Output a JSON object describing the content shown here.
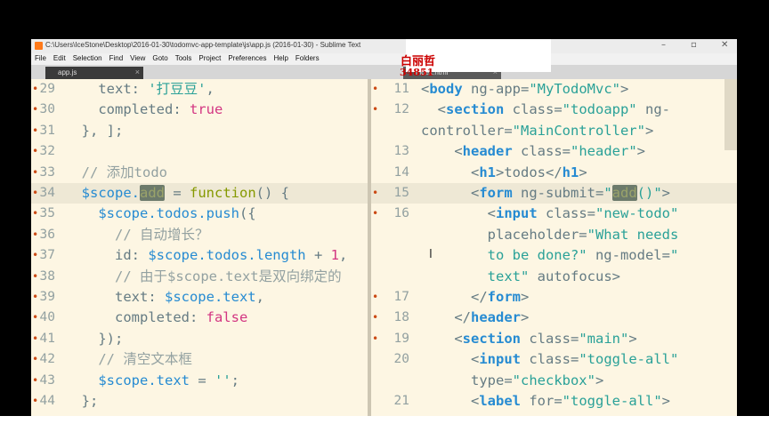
{
  "window": {
    "title": "C:\\Users\\IceStone\\Desktop\\2016-01-30\\todomvc-app-template\\js\\app.js (2016-01-30) - Sublime Text",
    "controls": {
      "minimize": "–",
      "maximize": "▫",
      "close": "✕"
    }
  },
  "menu": [
    "File",
    "Edit",
    "Selection",
    "Find",
    "View",
    "Goto",
    "Tools",
    "Project",
    "Preferences",
    "Help",
    "Folders"
  ],
  "tabs": [
    {
      "label": "app.js",
      "close": "×"
    },
    {
      "label": "index.html",
      "close": "×"
    }
  ],
  "overlay": {
    "name": "白丽哲",
    "number": "34851"
  },
  "left_pane": {
    "lines": [
      {
        "n": "29",
        "mark": "•",
        "tokens": [
          [
            "pun",
            "    text: "
          ],
          [
            "str",
            "'打豆豆'"
          ],
          [
            "pun",
            ","
          ]
        ]
      },
      {
        "n": "30",
        "mark": "•",
        "tokens": [
          [
            "pun",
            "    completed: "
          ],
          [
            "num",
            "true"
          ]
        ]
      },
      {
        "n": "31",
        "mark": "•",
        "tokens": [
          [
            "pun",
            "  }, ];"
          ]
        ]
      },
      {
        "n": "32",
        "mark": "•",
        "tokens": []
      },
      {
        "n": "33",
        "mark": "•",
        "tokens": [
          [
            "cm",
            "  // 添加todo"
          ]
        ]
      },
      {
        "n": "34",
        "mark": "•",
        "tokens": [
          [
            "var",
            "  $scope."
          ],
          [
            "hl",
            "add"
          ],
          [
            "pun",
            " = "
          ],
          [
            "kw",
            "function"
          ],
          [
            "pun",
            "() {"
          ]
        ]
      },
      {
        "n": "35",
        "mark": "•",
        "tokens": [
          [
            "var",
            "    $scope.todos.push"
          ],
          [
            "pun",
            "({"
          ]
        ]
      },
      {
        "n": "36",
        "mark": "•",
        "tokens": [
          [
            "cm",
            "      // 自动增长？"
          ]
        ]
      },
      {
        "n": "37",
        "mark": "•",
        "tokens": [
          [
            "pun",
            "      id: "
          ],
          [
            "var",
            "$scope.todos.length"
          ],
          [
            "pun",
            " + "
          ],
          [
            "num",
            "1"
          ],
          [
            "pun",
            ","
          ]
        ]
      },
      {
        "n": "38",
        "mark": "•",
        "tokens": [
          [
            "cm",
            "      // 由于$scope.text是双向绑定的"
          ]
        ]
      },
      {
        "n": "39",
        "mark": "•",
        "tokens": [
          [
            "pun",
            "      text: "
          ],
          [
            "var",
            "$scope.text"
          ],
          [
            "pun",
            ","
          ]
        ]
      },
      {
        "n": "40",
        "mark": "•",
        "tokens": [
          [
            "pun",
            "      completed: "
          ],
          [
            "num",
            "false"
          ]
        ]
      },
      {
        "n": "41",
        "mark": "•",
        "tokens": [
          [
            "pun",
            "    });"
          ]
        ]
      },
      {
        "n": "42",
        "mark": "•",
        "tokens": [
          [
            "cm",
            "    // 清空文本框"
          ]
        ]
      },
      {
        "n": "43",
        "mark": "•",
        "tokens": [
          [
            "var",
            "    $scope.text"
          ],
          [
            "pun",
            " = "
          ],
          [
            "str",
            "''"
          ],
          [
            "pun",
            ";"
          ]
        ]
      },
      {
        "n": "44",
        "mark": "•",
        "tokens": [
          [
            "pun",
            "  };"
          ]
        ]
      }
    ]
  },
  "right_pane": {
    "lines": [
      {
        "n": "11",
        "mark": "•",
        "tokens": [
          [
            "pun",
            "<"
          ],
          [
            "tag",
            "body"
          ],
          [
            "pun",
            " ng-app="
          ],
          [
            "str",
            "\"MyTodoMvc\""
          ],
          [
            "pun",
            ">"
          ]
        ]
      },
      {
        "n": "12",
        "mark": "•",
        "tokens": [
          [
            "pun",
            "  <"
          ],
          [
            "tag",
            "section"
          ],
          [
            "pun",
            " class="
          ],
          [
            "str",
            "\"todoapp\""
          ],
          [
            "pun",
            " ng-"
          ]
        ]
      },
      {
        "n": "",
        "mark": "",
        "tokens": [
          [
            "pun",
            "controller="
          ],
          [
            "str",
            "\"MainController\""
          ],
          [
            "pun",
            ">"
          ]
        ]
      },
      {
        "n": "13",
        "mark": "",
        "tokens": [
          [
            "pun",
            "    <"
          ],
          [
            "tag",
            "header"
          ],
          [
            "pun",
            " class="
          ],
          [
            "str",
            "\"header\""
          ],
          [
            "pun",
            ">"
          ]
        ]
      },
      {
        "n": "14",
        "mark": "",
        "tokens": [
          [
            "pun",
            "      <"
          ],
          [
            "tag",
            "h1"
          ],
          [
            "pun",
            ">todos</"
          ],
          [
            "tag",
            "h1"
          ],
          [
            "pun",
            ">"
          ]
        ]
      },
      {
        "n": "15",
        "mark": "•",
        "tokens": [
          [
            "pun",
            "      <"
          ],
          [
            "tag",
            "form"
          ],
          [
            "pun",
            " ng-submit="
          ],
          [
            "str",
            "\""
          ],
          [
            "hl",
            "add"
          ],
          [
            "str",
            "()\""
          ],
          [
            "pun",
            ">"
          ]
        ]
      },
      {
        "n": "16",
        "mark": "•",
        "tokens": [
          [
            "pun",
            "        <"
          ],
          [
            "tag",
            "input"
          ],
          [
            "pun",
            " class="
          ],
          [
            "str",
            "\"new-todo\""
          ]
        ]
      },
      {
        "n": "",
        "mark": "",
        "tokens": [
          [
            "pun",
            "        placeholder="
          ],
          [
            "str",
            "\"What needs"
          ]
        ]
      },
      {
        "n": "",
        "mark": "",
        "tokens": [
          [
            "str",
            "        to be done?\""
          ],
          [
            "pun",
            " ng-model="
          ],
          [
            "str",
            "\""
          ]
        ]
      },
      {
        "n": "",
        "mark": "",
        "tokens": [
          [
            "str",
            "        text\""
          ],
          [
            "pun",
            " autofocus>"
          ]
        ]
      },
      {
        "n": "17",
        "mark": "•",
        "tokens": [
          [
            "pun",
            "      </"
          ],
          [
            "tag",
            "form"
          ],
          [
            "pun",
            ">"
          ]
        ]
      },
      {
        "n": "18",
        "mark": "•",
        "tokens": [
          [
            "pun",
            "    </"
          ],
          [
            "tag",
            "header"
          ],
          [
            "pun",
            ">"
          ]
        ]
      },
      {
        "n": "19",
        "mark": "•",
        "tokens": [
          [
            "pun",
            "    <"
          ],
          [
            "tag",
            "section"
          ],
          [
            "pun",
            " class="
          ],
          [
            "str",
            "\"main\""
          ],
          [
            "pun",
            ">"
          ]
        ]
      },
      {
        "n": "20",
        "mark": "",
        "tokens": [
          [
            "pun",
            "      <"
          ],
          [
            "tag",
            "input"
          ],
          [
            "pun",
            " class="
          ],
          [
            "str",
            "\"toggle-all\""
          ]
        ]
      },
      {
        "n": "",
        "mark": "",
        "tokens": [
          [
            "pun",
            "      type="
          ],
          [
            "str",
            "\"checkbox\""
          ],
          [
            "pun",
            ">"
          ]
        ]
      },
      {
        "n": "21",
        "mark": "",
        "tokens": [
          [
            "pun",
            "      <"
          ],
          [
            "tag",
            "label"
          ],
          [
            "pun",
            " for="
          ],
          [
            "str",
            "\"toggle-all\""
          ],
          [
            "pun",
            ">"
          ]
        ]
      }
    ]
  },
  "theme": {
    "bg": "#fdf6e3",
    "accent": "#268bd2",
    "string": "#2aa198"
  }
}
